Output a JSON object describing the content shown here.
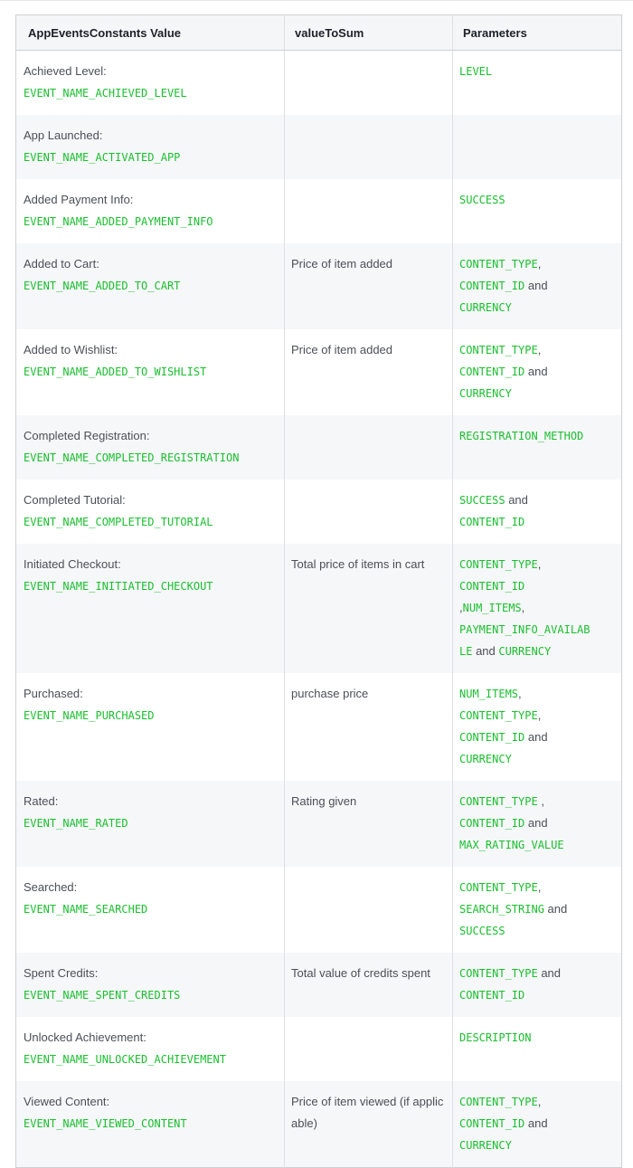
{
  "headers": [
    "AppEventsConstants Value",
    "valueToSum",
    "Parameters"
  ],
  "rows": [
    {
      "label": "Achieved Level:",
      "constant": "EVENT_NAME_ACHIEVED_LEVEL",
      "value": "",
      "params": [
        {
          "t": "LEVEL",
          "c": true
        }
      ]
    },
    {
      "label": "App Launched:",
      "constant": "EVENT_NAME_ACTIVATED_APP",
      "value": "",
      "params": []
    },
    {
      "label": "Added Payment Info:",
      "constant": "EVENT_NAME_ADDED_PAYMENT_INFO",
      "value": "",
      "params": [
        {
          "t": "SUCCESS",
          "c": true
        }
      ]
    },
    {
      "label": "Added to Cart:",
      "constant": "EVENT_NAME_ADDED_TO_CART",
      "value": "Price of item added",
      "params": [
        {
          "t": "CONTENT_TYPE",
          "c": true
        },
        {
          "t": ",",
          "c": false
        },
        {
          "br": true
        },
        {
          "t": "CONTENT_ID",
          "c": true
        },
        {
          "t": " and",
          "c": false
        },
        {
          "br": true
        },
        {
          "t": "CURRENCY",
          "c": true
        }
      ]
    },
    {
      "label": "Added to Wishlist:",
      "constant": "EVENT_NAME_ADDED_TO_WISHLIST",
      "value": "Price of item added",
      "params": [
        {
          "t": "CONTENT_TYPE",
          "c": true
        },
        {
          "t": ",",
          "c": false
        },
        {
          "br": true
        },
        {
          "t": "CONTENT_ID",
          "c": true
        },
        {
          "t": " and",
          "c": false
        },
        {
          "br": true
        },
        {
          "t": "CURRENCY",
          "c": true
        }
      ]
    },
    {
      "label": "Completed Registration:",
      "constant": "EVENT_NAME_COMPLETED_REGISTRATION",
      "value": "",
      "params": [
        {
          "t": "REGISTRATION_METHOD",
          "c": true
        }
      ]
    },
    {
      "label": "Completed Tutorial:",
      "constant": "EVENT_NAME_COMPLETED_TUTORIAL",
      "value": "",
      "params": [
        {
          "t": "SUCCESS",
          "c": true
        },
        {
          "t": " and",
          "c": false
        },
        {
          "br": true
        },
        {
          "t": "CONTENT_ID",
          "c": true
        }
      ]
    },
    {
      "label": "Initiated Checkout:",
      "constant": "EVENT_NAME_INITIATED_CHECKOUT",
      "value": "Total price of items in cart",
      "params": [
        {
          "t": "CONTENT_TYPE",
          "c": true
        },
        {
          "t": ",",
          "c": false
        },
        {
          "br": true
        },
        {
          "t": "CONTENT_ID",
          "c": true
        },
        {
          "br": true
        },
        {
          "t": ",",
          "c": false
        },
        {
          "t": "NUM_ITEMS",
          "c": true
        },
        {
          "t": ",",
          "c": false
        },
        {
          "br": true
        },
        {
          "t": "PAYMENT_INFO_AVAILAB",
          "c": true
        },
        {
          "br": true
        },
        {
          "t": "LE",
          "c": true
        },
        {
          "t": " and ",
          "c": false
        },
        {
          "t": "CURRENCY",
          "c": true
        }
      ]
    },
    {
      "label": "Purchased:",
      "constant": "EVENT_NAME_PURCHASED",
      "value": "purchase price",
      "params": [
        {
          "t": "NUM_ITEMS",
          "c": true
        },
        {
          "t": ",",
          "c": false
        },
        {
          "br": true
        },
        {
          "t": "CONTENT_TYPE",
          "c": true
        },
        {
          "t": ",",
          "c": false
        },
        {
          "br": true
        },
        {
          "t": "CONTENT_ID",
          "c": true
        },
        {
          "t": " and",
          "c": false
        },
        {
          "br": true
        },
        {
          "t": "CURRENCY",
          "c": true
        }
      ]
    },
    {
      "label": "Rated:",
      "constant": "EVENT_NAME_RATED",
      "value": "Rating given",
      "params": [
        {
          "t": "CONTENT_TYPE",
          "c": true
        },
        {
          "t": " ,",
          "c": false
        },
        {
          "br": true
        },
        {
          "t": "CONTENT_ID",
          "c": true
        },
        {
          "t": " and",
          "c": false
        },
        {
          "br": true
        },
        {
          "t": "MAX_RATING_VALUE",
          "c": true
        }
      ]
    },
    {
      "label": "Searched:",
      "constant": "EVENT_NAME_SEARCHED",
      "value": "",
      "params": [
        {
          "t": "CONTENT_TYPE",
          "c": true
        },
        {
          "t": ",",
          "c": false
        },
        {
          "br": true
        },
        {
          "t": "SEARCH_STRING",
          "c": true
        },
        {
          "t": " and",
          "c": false
        },
        {
          "br": true
        },
        {
          "t": "SUCCESS",
          "c": true
        }
      ]
    },
    {
      "label": "Spent Credits:",
      "constant": "EVENT_NAME_SPENT_CREDITS",
      "value": "Total value of credits spent",
      "params": [
        {
          "t": "CONTENT_TYPE",
          "c": true
        },
        {
          "t": " and",
          "c": false
        },
        {
          "br": true
        },
        {
          "t": "CONTENT_ID",
          "c": true
        }
      ]
    },
    {
      "label": "Unlocked Achievement:",
      "constant": "EVENT_NAME_UNLOCKED_ACHIEVEMENT",
      "value": "",
      "params": [
        {
          "t": "DESCRIPTION",
          "c": true
        }
      ]
    },
    {
      "label": "Viewed Content:",
      "constant": "EVENT_NAME_VIEWED_CONTENT",
      "value": "Price of item viewed (if applicable)",
      "params": [
        {
          "t": "CONTENT_TYPE",
          "c": true
        },
        {
          "t": ",",
          "c": false
        },
        {
          "br": true
        },
        {
          "t": "CONTENT_ID",
          "c": true
        },
        {
          "t": " and",
          "c": false
        },
        {
          "br": true
        },
        {
          "t": "CURRENCY",
          "c": true
        }
      ]
    }
  ]
}
